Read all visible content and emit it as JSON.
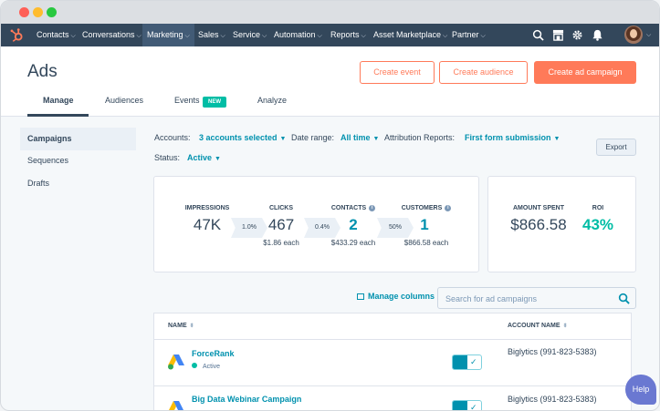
{
  "nav": {
    "items": [
      {
        "label": "Contacts"
      },
      {
        "label": "Conversations"
      },
      {
        "label": "Marketing"
      },
      {
        "label": "Sales"
      },
      {
        "label": "Service"
      },
      {
        "label": "Automation"
      },
      {
        "label": "Reports"
      },
      {
        "label": "Asset Marketplace"
      },
      {
        "label": "Partner"
      }
    ],
    "active": "Marketing",
    "icons": [
      "search-icon",
      "marketplace-icon",
      "settings-icon",
      "notifications-icon"
    ]
  },
  "header": {
    "title": "Ads",
    "buttons": {
      "create_event": "Create event",
      "create_audience": "Create audience",
      "create_campaign": "Create ad campaign"
    },
    "tabs": [
      {
        "label": "Manage"
      },
      {
        "label": "Audiences"
      },
      {
        "label": "Events"
      },
      {
        "label": "Analyze"
      }
    ],
    "new_badge": "NEW"
  },
  "sidebar": {
    "items": [
      {
        "label": "Campaigns"
      },
      {
        "label": "Sequences"
      },
      {
        "label": "Drafts"
      }
    ]
  },
  "filters": {
    "accounts_label": "Accounts:",
    "accounts_value": "3 accounts selected",
    "date_label": "Date range:",
    "date_value": "All time",
    "attribution_label": "Attribution Reports:",
    "attribution_value": "First form submission",
    "status_label": "Status:",
    "status_value": "Active",
    "export": "Export"
  },
  "stats": {
    "impressions": {
      "label": "IMPRESSIONS",
      "value": "47K"
    },
    "rate1": "1.0%",
    "clicks": {
      "label": "CLICKS",
      "value": "467",
      "sub": "$1.86 each"
    },
    "rate2": "0.4%",
    "contacts": {
      "label": "CONTACTS",
      "value": "2",
      "sub": "$433.29 each"
    },
    "rate3": "50%",
    "customers": {
      "label": "CUSTOMERS",
      "value": "1",
      "sub": "$866.58 each"
    },
    "amount_spent": {
      "label": "AMOUNT SPENT",
      "value": "$866.58"
    },
    "roi": {
      "label": "ROI",
      "value": "43%"
    }
  },
  "search": {
    "manage_columns": "Manage columns",
    "placeholder": "Search for ad campaigns"
  },
  "table": {
    "headers": {
      "name": "NAME",
      "account": "ACCOUNT NAME"
    },
    "rows": [
      {
        "name": "ForceRank",
        "status": "Active",
        "account": "Biglytics (991-823-5383)"
      },
      {
        "name": "Big Data Webinar Campaign",
        "status": "",
        "account": "Biglytics (991-823-5383)"
      }
    ]
  },
  "help": "Help",
  "colors": {
    "accent": "#ff7a59",
    "link": "#0091ae",
    "nav": "#33475b",
    "positive": "#00bda5"
  }
}
